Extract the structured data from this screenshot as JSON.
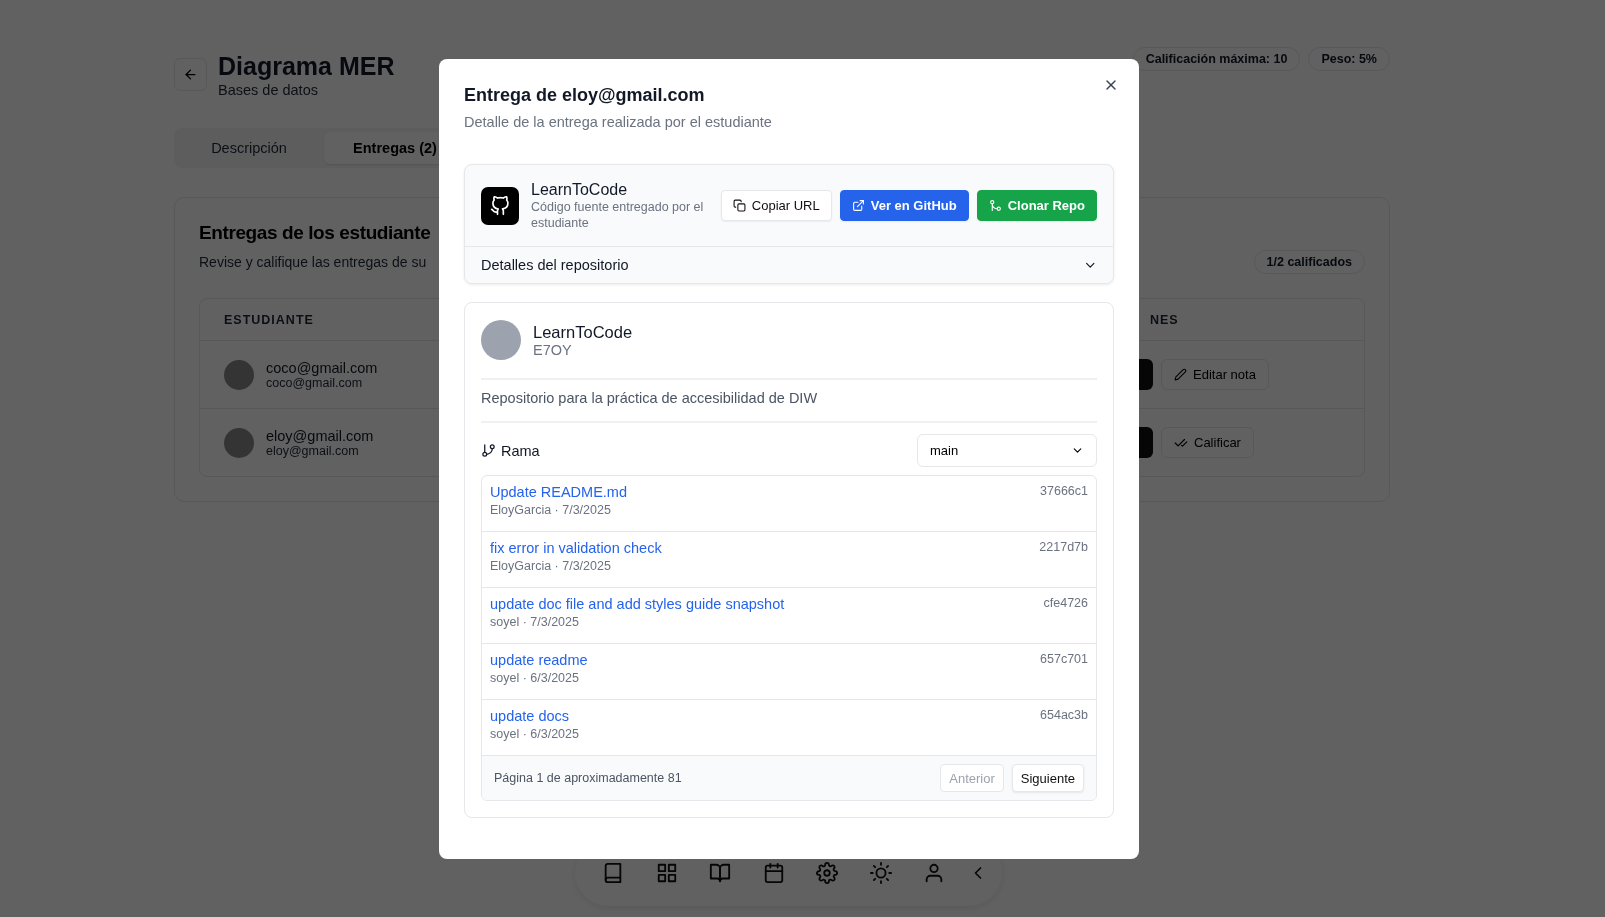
{
  "page": {
    "title": "Diagrama MER",
    "subtitle": "Bases de datos",
    "badges": [
      "Calificación máxima: 10",
      "Peso: 5%"
    ]
  },
  "tabs": [
    {
      "label": "Descripción",
      "selected": false
    },
    {
      "label": "Entregas (2)",
      "selected": true
    }
  ],
  "submissions_card": {
    "title": "Entregas de los estudiante",
    "subtitle": "Revise y califique las entregas de su",
    "badge": "1/2 calificados",
    "columns": [
      "ESTUDIANTE",
      "NES"
    ],
    "rows": [
      {
        "name": "coco@gmail.com",
        "email": "coco@gmail.com",
        "action": {
          "kind": "edit",
          "label": "Editar nota"
        }
      },
      {
        "name": "eloy@gmail.com",
        "email": "eloy@gmail.com",
        "action": {
          "kind": "grade",
          "label": "Calificar"
        }
      }
    ]
  },
  "dialog": {
    "title": "Entrega de eloy@gmail.com",
    "subtitle": "Detalle de la entrega realizada por el estudiante",
    "repo": {
      "name": "LearnToCode",
      "description": "Código fuente entregado por el estudiante",
      "buttons": [
        {
          "kind": "copy",
          "label": "Copiar URL"
        },
        {
          "kind": "github",
          "label": "Ver en GitHub"
        },
        {
          "kind": "clone",
          "label": "Clonar Repo"
        }
      ],
      "details": {
        "label": "Detalles del repositorio",
        "expanded": false
      }
    },
    "project": {
      "name": "LearnToCode",
      "owner": "E7OY",
      "description": "Repositorio para la práctica de accesibilidad de DIW",
      "branch_label": "Rama",
      "branch": "main",
      "commits": [
        {
          "message": "Update README.md",
          "meta": "EloyGarcia · 7/3/2025",
          "sha": "37666c1"
        },
        {
          "message": "fix error in validation check",
          "meta": "EloyGarcia · 7/3/2025",
          "sha": "2217d7b"
        },
        {
          "message": "update doc file and add styles guide snapshot",
          "meta": "soyel · 7/3/2025",
          "sha": "cfe4726"
        },
        {
          "message": "update readme",
          "meta": "soyel · 6/3/2025",
          "sha": "657c701"
        },
        {
          "message": "update docs",
          "meta": "soyel · 6/3/2025",
          "sha": "654ac3b"
        }
      ],
      "pagination": {
        "text": "Página 1 de aproximadamente 81",
        "buttons": [
          {
            "label": "Anterior",
            "disabled": true
          },
          {
            "label": "Siguiente",
            "disabled": false
          }
        ]
      }
    }
  }
}
